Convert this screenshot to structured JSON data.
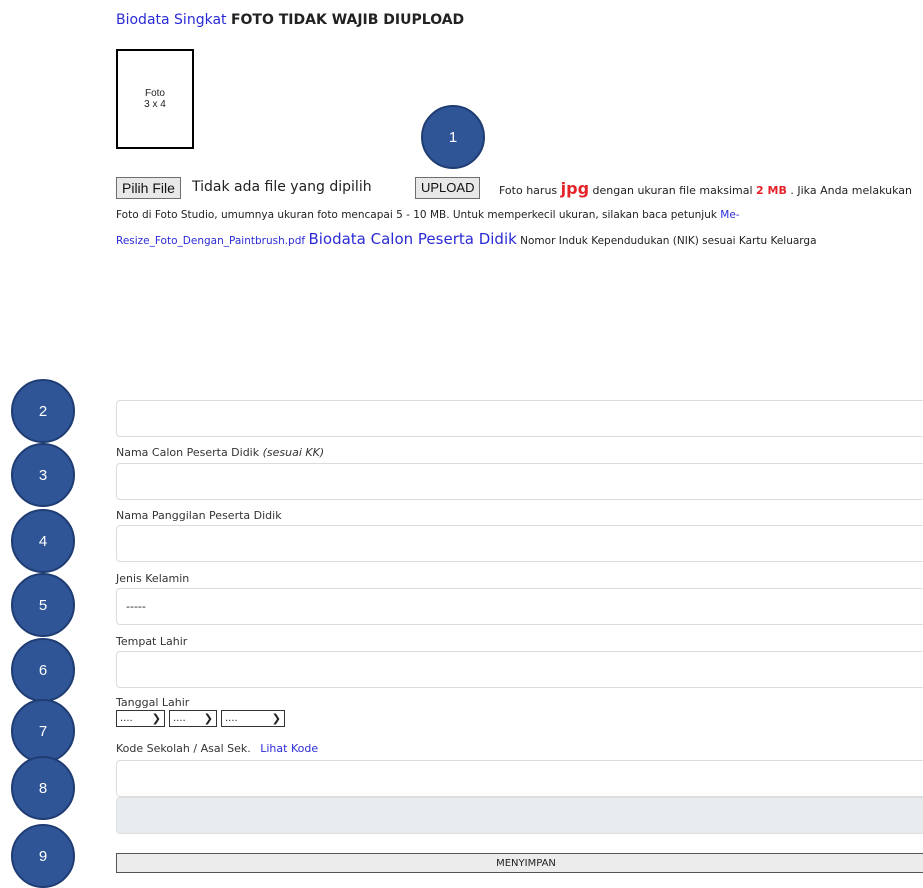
{
  "header": {
    "title_link": "Biodata Singkat",
    "title_note": "FOTO TIDAK WAJIB DIUPLOAD"
  },
  "photo": {
    "line1": "Foto",
    "line2": "3 x 4"
  },
  "badges": [
    "1",
    "2",
    "3",
    "4",
    "5",
    "6",
    "7",
    "8",
    "9"
  ],
  "upload": {
    "choose_button": "Pilih File",
    "no_file_text": "Tidak ada file yang dipilih",
    "upload_button": "UPLOAD",
    "info_prefix": "Foto harus",
    "info_jpg": "jpg",
    "info_mid": "dengan ukuran file maksimal",
    "info_size": "2 MB",
    "info_suffix": ". Jika Anda melakukan",
    "line2": "Foto di Foto Studio, umumnya ukuran foto mencapai 5 - 10 MB. Untuk memperkecil ukuran, silakan baca petunjuk",
    "link_part1": "Me-",
    "link_part2": "Resize_Foto_Dengan_Paintbrush.pdf",
    "section_title": "Biodata Calon Peserta Didik",
    "nik_text": "Nomor Induk Kependudukan (NIK) sesuai Kartu Keluarga"
  },
  "form": {
    "name_label": "Nama Calon Peserta Didik",
    "name_hint": "(sesuai KK)",
    "nickname_label": "Nama Panggilan Peserta Didik",
    "gender_label": "Jenis Kelamin",
    "gender_value": "-----",
    "birthplace_label": "Tempat Lahir",
    "birthdate_label": "Tanggal Lahir",
    "date_day": "....",
    "date_month": "....",
    "date_year": "....",
    "school_label": "Kode Sekolah / Asal Sek.",
    "school_link": "Lihat Kode",
    "save_button": "MENYIMPAN"
  },
  "colors": {
    "badge": "#2f5597",
    "link": "#2b2bd6",
    "accent_red": "#e3242b"
  }
}
